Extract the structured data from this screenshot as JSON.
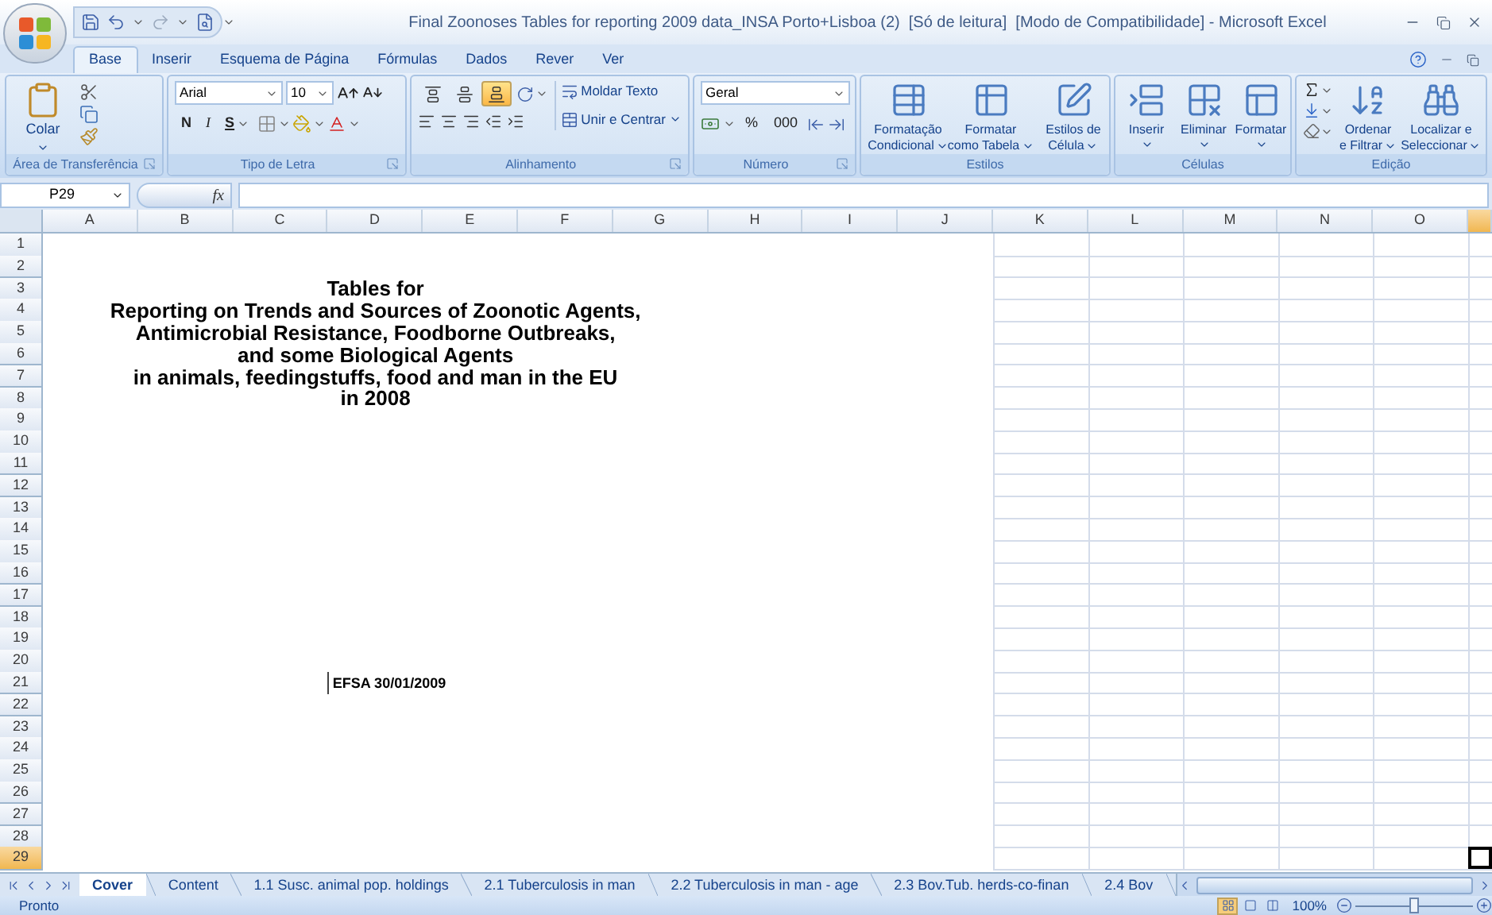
{
  "window": {
    "title": "Final Zoonoses Tables for reporting 2009 data_INSA Porto+Lisboa (2)  [Só de leitura]  [Modo de Compatibilidade] - Microsoft Excel"
  },
  "ribbon_tabs": [
    {
      "label": "Base",
      "selected": true
    },
    {
      "label": "Inserir",
      "selected": false
    },
    {
      "label": "Esquema de Página",
      "selected": false
    },
    {
      "label": "Fórmulas",
      "selected": false
    },
    {
      "label": "Dados",
      "selected": false
    },
    {
      "label": "Rever",
      "selected": false
    },
    {
      "label": "Ver",
      "selected": false
    }
  ],
  "clipboard": {
    "label": "Área de Transferência",
    "paste": "Colar"
  },
  "font": {
    "label": "Tipo de Letra",
    "name": "Arial",
    "size": "10",
    "bold": "N",
    "italic": "I",
    "underline": "S"
  },
  "alignment": {
    "label": "Alinhamento",
    "vertical": [
      {
        "selected": false
      },
      {
        "selected": false
      },
      {
        "selected": true
      }
    ],
    "wrap": "Moldar Texto",
    "merge": "Unir e Centrar"
  },
  "number": {
    "label": "Número",
    "format": "Geral",
    "percent": "%",
    "thousands": "000"
  },
  "styles": {
    "label": "Estilos",
    "buttons": [
      {
        "lines": [
          "Formatação",
          "Condicional"
        ]
      },
      {
        "lines": [
          "Formatar",
          "como Tabela"
        ]
      },
      {
        "lines": [
          "Estilos de",
          "Célula"
        ]
      }
    ]
  },
  "cells": {
    "label": "Células",
    "buttons": [
      "Inserir",
      "Eliminar",
      "Formatar"
    ]
  },
  "editing": {
    "label": "Edição",
    "buttons": [
      {
        "lines": [
          "Ordenar",
          "e Filtrar"
        ]
      },
      {
        "lines": [
          "Localizar e",
          "Seleccionar"
        ]
      }
    ]
  },
  "formula_bar": {
    "name_box": "P29",
    "fx": "fx"
  },
  "columns": [
    {
      "label": "A",
      "selected": false
    },
    {
      "label": "B",
      "selected": false
    },
    {
      "label": "C",
      "selected": false
    },
    {
      "label": "D",
      "selected": false
    },
    {
      "label": "E",
      "selected": false
    },
    {
      "label": "F",
      "selected": false
    },
    {
      "label": "G",
      "selected": false
    },
    {
      "label": "H",
      "selected": false
    },
    {
      "label": "I",
      "selected": false
    },
    {
      "label": "J",
      "selected": false
    },
    {
      "label": "K",
      "selected": false
    },
    {
      "label": "L",
      "selected": false
    },
    {
      "label": "M",
      "selected": false
    },
    {
      "label": "N",
      "selected": false
    },
    {
      "label": "O",
      "selected": false
    },
    {
      "selected": true
    }
  ],
  "rows": [
    {
      "label": "1",
      "selected": false
    },
    {
      "label": "2",
      "selected": false
    },
    {
      "label": "3",
      "selected": false,
      "cell": {
        "kind": "title",
        "text": "Tables for"
      }
    },
    {
      "label": "4",
      "selected": false,
      "cell": {
        "kind": "title",
        "text": "Reporting on Trends and Sources of Zoonotic Agents,"
      }
    },
    {
      "label": "5",
      "selected": false,
      "cell": {
        "kind": "title",
        "text": "Antimicrobial Resistance, Foodborne Outbreaks,"
      }
    },
    {
      "label": "6",
      "selected": false,
      "cell": {
        "kind": "title",
        "text": "and some Biological Agents"
      }
    },
    {
      "label": "7",
      "selected": false,
      "cell": {
        "kind": "title",
        "text": "in animals, feedingstuffs, food and man in the EU"
      }
    },
    {
      "label": "8",
      "selected": false,
      "cell": {
        "kind": "title",
        "text": "in 2008"
      }
    },
    {
      "label": "9",
      "selected": false
    },
    {
      "label": "10",
      "selected": false
    },
    {
      "label": "11",
      "selected": false
    },
    {
      "label": "12",
      "selected": false
    },
    {
      "label": "13",
      "selected": false
    },
    {
      "label": "14",
      "selected": false
    },
    {
      "label": "15",
      "selected": false
    },
    {
      "label": "16",
      "selected": false
    },
    {
      "label": "17",
      "selected": false
    },
    {
      "label": "18",
      "selected": false
    },
    {
      "label": "19",
      "selected": false
    },
    {
      "label": "20",
      "selected": false
    },
    {
      "label": "21",
      "selected": false,
      "cell": {
        "kind": "note",
        "text": "EFSA 30/01/2009"
      }
    },
    {
      "label": "22",
      "selected": false
    },
    {
      "label": "23",
      "selected": false
    },
    {
      "label": "24",
      "selected": false
    },
    {
      "label": "25",
      "selected": false
    },
    {
      "label": "26",
      "selected": false
    },
    {
      "label": "27",
      "selected": false
    },
    {
      "label": "28",
      "selected": false
    },
    {
      "label": "29",
      "selected": true
    }
  ],
  "sheet_tabs": [
    {
      "label": "Cover",
      "selected": true
    },
    {
      "label": "Content",
      "selected": false
    },
    {
      "label": "1.1 Susc. animal pop. holdings",
      "selected": false
    },
    {
      "label": "2.1 Tuberculosis in man",
      "selected": false
    },
    {
      "label": "2.2 Tuberculosis in man - age",
      "selected": false
    },
    {
      "label": "2.3 Bov.Tub. herds-co-finan",
      "selected": false
    },
    {
      "label": "2.4 Bov",
      "selected": false
    }
  ],
  "status_bar": {
    "status": "Pronto",
    "views": [
      {
        "selected": true
      },
      {
        "selected": false
      },
      {
        "selected": false
      }
    ],
    "zoom": {
      "reading": "100%",
      "level": 0.5
    }
  }
}
